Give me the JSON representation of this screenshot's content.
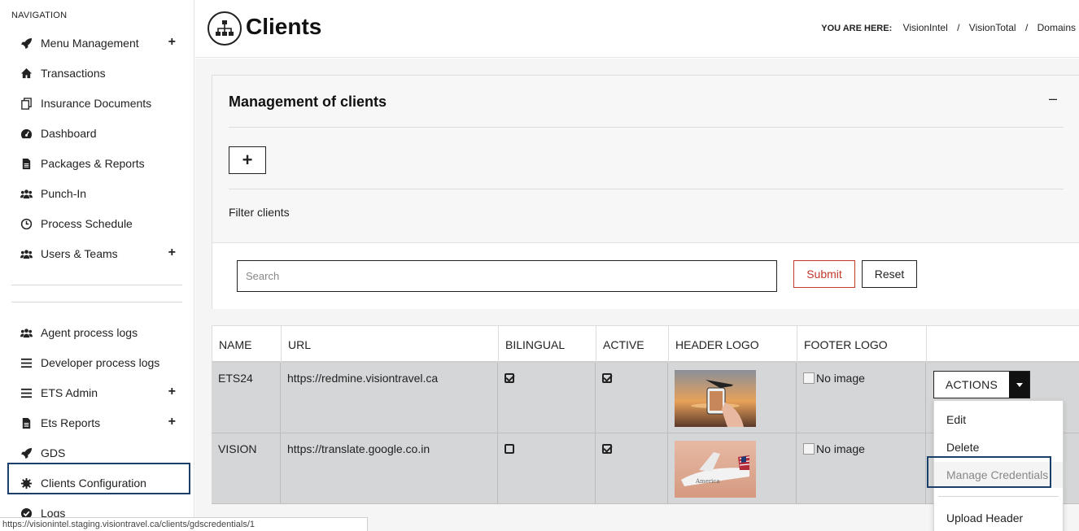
{
  "sidebar": {
    "heading": "NAVIGATION",
    "items": [
      {
        "label": "Menu Management",
        "icon": "rocket-icon",
        "expandable": true
      },
      {
        "label": "Transactions",
        "icon": "home-icon",
        "expandable": false
      },
      {
        "label": "Insurance Documents",
        "icon": "documents-icon",
        "expandable": false
      },
      {
        "label": "Dashboard",
        "icon": "dashboard-icon",
        "expandable": false
      },
      {
        "label": "Packages & Reports",
        "icon": "file-icon",
        "expandable": false
      },
      {
        "label": "Punch-In",
        "icon": "users-icon",
        "expandable": false
      },
      {
        "label": "Process Schedule",
        "icon": "clock-icon",
        "expandable": false
      },
      {
        "label": "Users & Teams",
        "icon": "users-icon",
        "expandable": true
      }
    ],
    "items2": [
      {
        "label": "Agent process logs",
        "icon": "users-icon",
        "expandable": false
      },
      {
        "label": "Developer process logs",
        "icon": "bars-icon",
        "expandable": false
      },
      {
        "label": "ETS Admin",
        "icon": "bars-icon",
        "expandable": true
      },
      {
        "label": "Ets Reports",
        "icon": "file-icon",
        "expandable": true
      },
      {
        "label": "GDS",
        "icon": "rocket-icon",
        "expandable": false
      },
      {
        "label": "Clients Configuration",
        "icon": "gear-icon",
        "expandable": false
      },
      {
        "label": "Logs",
        "icon": "check-circle-icon",
        "expandable": false
      }
    ],
    "plus_symbol": "+"
  },
  "header": {
    "title": "Clients",
    "icon": "sitemap-icon",
    "breadcrumb_label": "YOU ARE HERE:",
    "breadcrumb": [
      "VisionIntel",
      "VisionTotal",
      "Domains"
    ],
    "breadcrumb_sep": "/"
  },
  "panel": {
    "title": "Management of clients",
    "collapse_symbol": "–",
    "add_symbol": "+",
    "filter_label": "Filter clients",
    "search_placeholder": "Search",
    "submit_label": "Submit",
    "reset_label": "Reset"
  },
  "table": {
    "columns": [
      "NAME",
      "URL",
      "BILINGUAL",
      "ACTIVE",
      "HEADER LOGO",
      "FOOTER LOGO",
      ""
    ],
    "rows": [
      {
        "name": "ETS24",
        "url": "https://redmine.visiontravel.ca",
        "bilingual": true,
        "active": true,
        "header_logo": "plane-phone-image",
        "footer_logo": "No image"
      },
      {
        "name": "VISION",
        "url": "https://translate.google.co.in",
        "bilingual": false,
        "active": true,
        "header_logo": "airliner-image",
        "footer_logo": "No image"
      }
    ],
    "actions_label": "ACTIONS"
  },
  "dropdown": {
    "items": [
      "Edit",
      "Delete",
      "Manage Credentials",
      "Upload Header"
    ]
  },
  "status_bar": {
    "url": "https://visionintel.staging.visiontravel.ca/clients/gdscredentials/1"
  },
  "colors": {
    "accent_red": "#c0392b",
    "highlight_blue": "#1a3f6b",
    "row_bg": "#d4d6d7"
  }
}
